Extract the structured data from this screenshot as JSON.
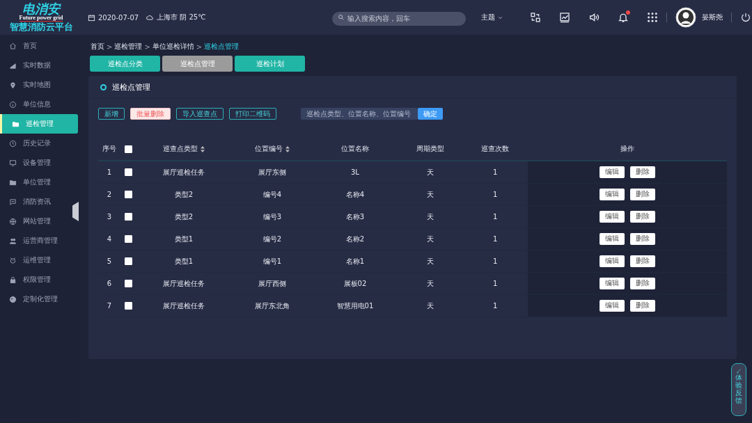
{
  "logo": {
    "brand": "电消安",
    "tagline": "Future power grid",
    "platform": "智慧消防云平台"
  },
  "header": {
    "date": "2020-07-07",
    "weather": "上海市 阴 25℃",
    "search_placeholder": "输入搜索内容，回车",
    "theme": "主题",
    "notification_dot": true,
    "user": "晏斯尧"
  },
  "sidebar": {
    "items": [
      {
        "label": "首页",
        "selected": false
      },
      {
        "label": "实时数据",
        "selected": false
      },
      {
        "label": "实时地图",
        "selected": false
      },
      {
        "label": "单位信息",
        "selected": false
      },
      {
        "label": "巡检管理",
        "selected": true
      },
      {
        "label": "历史记录",
        "selected": false
      },
      {
        "label": "设备管理",
        "selected": false
      },
      {
        "label": "单位管理",
        "selected": false
      },
      {
        "label": "消防资讯",
        "selected": false
      },
      {
        "label": "网站管理",
        "selected": false
      },
      {
        "label": "运营商管理",
        "selected": false
      },
      {
        "label": "运维管理",
        "selected": false
      },
      {
        "label": "权限管理",
        "selected": false
      },
      {
        "label": "定制化管理",
        "selected": false
      }
    ]
  },
  "breadcrumb": {
    "separator": ">",
    "items": [
      "首页",
      "巡检管理",
      "单位巡检详情",
      "巡检点管理"
    ]
  },
  "tabs": [
    {
      "label": "巡检点分类",
      "selected": false
    },
    {
      "label": "巡检点管理",
      "selected": true
    },
    {
      "label": "巡检计划",
      "selected": false
    }
  ],
  "panel": {
    "title": "巡检点管理",
    "toolbar": [
      {
        "label": "新增",
        "kind": "outline"
      },
      {
        "label": "批量删除",
        "kind": "danger"
      },
      {
        "label": "导入巡查点",
        "kind": "outline"
      },
      {
        "label": "打印二维码",
        "kind": "outline"
      }
    ],
    "search_placeholder": "巡检点类型、位置名称、位置编号",
    "search_button": "确定",
    "table": {
      "columns": [
        {
          "label": "序号",
          "sortable": false
        },
        {
          "label": "巡查点类型",
          "sortable": true
        },
        {
          "label": "位置编号",
          "sortable": true
        },
        {
          "label": "位置名称",
          "sortable": false
        },
        {
          "label": "周期类型",
          "sortable": false
        },
        {
          "label": "巡查次数",
          "sortable": false
        },
        {
          "label": "操作",
          "sortable": false
        }
      ],
      "all_checked": false,
      "rows": [
        {
          "index": "1",
          "checked": false,
          "type": "展厅巡检任务",
          "code": "展厅东侧",
          "name": "3L",
          "cycle": "天",
          "count": "1",
          "actions": [
            "编辑",
            "删除"
          ]
        },
        {
          "index": "2",
          "checked": false,
          "type": "类型2",
          "code": "编号4",
          "name": "名称4",
          "cycle": "天",
          "count": "1",
          "actions": [
            "编辑",
            "删除"
          ]
        },
        {
          "index": "3",
          "checked": false,
          "type": "类型2",
          "code": "编号3",
          "name": "名称3",
          "cycle": "天",
          "count": "1",
          "actions": [
            "编辑",
            "删除"
          ]
        },
        {
          "index": "4",
          "checked": false,
          "type": "类型1",
          "code": "编号2",
          "name": "名称2",
          "cycle": "天",
          "count": "1",
          "actions": [
            "编辑",
            "删除"
          ]
        },
        {
          "index": "5",
          "checked": false,
          "type": "类型1",
          "code": "编号1",
          "name": "名称1",
          "cycle": "天",
          "count": "1",
          "actions": [
            "编辑",
            "删除"
          ]
        },
        {
          "index": "6",
          "checked": false,
          "type": "展厅巡检任务",
          "code": "展厅西侧",
          "name": "展板02",
          "cycle": "天",
          "count": "1",
          "actions": [
            "编辑",
            "删除"
          ]
        },
        {
          "index": "7",
          "checked": false,
          "type": "展厅巡检任务",
          "code": "展厅东北角",
          "name": "智慧用电01",
          "cycle": "天",
          "count": "1",
          "actions": [
            "编辑",
            "删除"
          ]
        }
      ]
    }
  },
  "feedback": "体验反馈"
}
